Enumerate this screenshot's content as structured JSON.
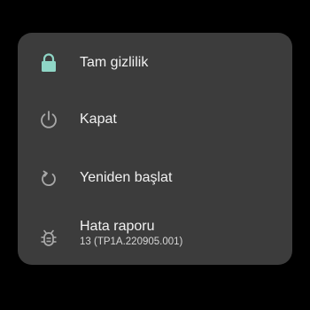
{
  "power_menu": {
    "items": [
      {
        "label": "Tam gizlilik",
        "icon": "lock-icon",
        "icon_color": "#8fd6c6"
      },
      {
        "label": "Kapat",
        "icon": "power-icon",
        "icon_color": "#a8a8a8"
      },
      {
        "label": "Yeniden başlat",
        "icon": "restart-icon",
        "icon_color": "#a8a8a8"
      },
      {
        "label": "Hata raporu",
        "sublabel": "13 (TP1A.220905.001)",
        "icon": "bug-icon",
        "icon_color": "#a8a8a8"
      }
    ]
  }
}
